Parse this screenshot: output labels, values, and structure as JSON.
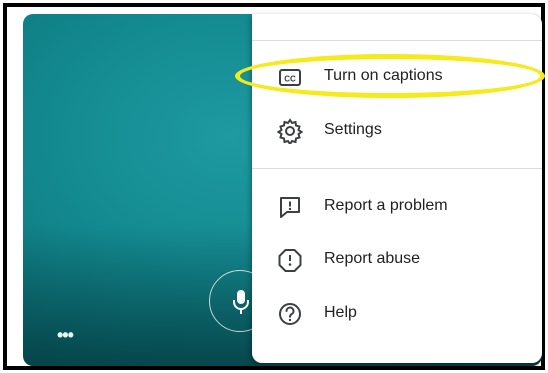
{
  "menu": {
    "items": [
      {
        "label": "Turn on captions",
        "icon": "closed-captions-icon"
      },
      {
        "label": "Settings",
        "icon": "gear-icon"
      },
      {
        "label": "Report a problem",
        "icon": "feedback-icon"
      },
      {
        "label": "Report abuse",
        "icon": "report-icon"
      },
      {
        "label": "Help",
        "icon": "help-icon"
      }
    ]
  },
  "video": {
    "more_glyph": "•••"
  },
  "colors": {
    "highlight": "#f4ea1c",
    "video_bg": "#138a90",
    "text": "#202124"
  }
}
